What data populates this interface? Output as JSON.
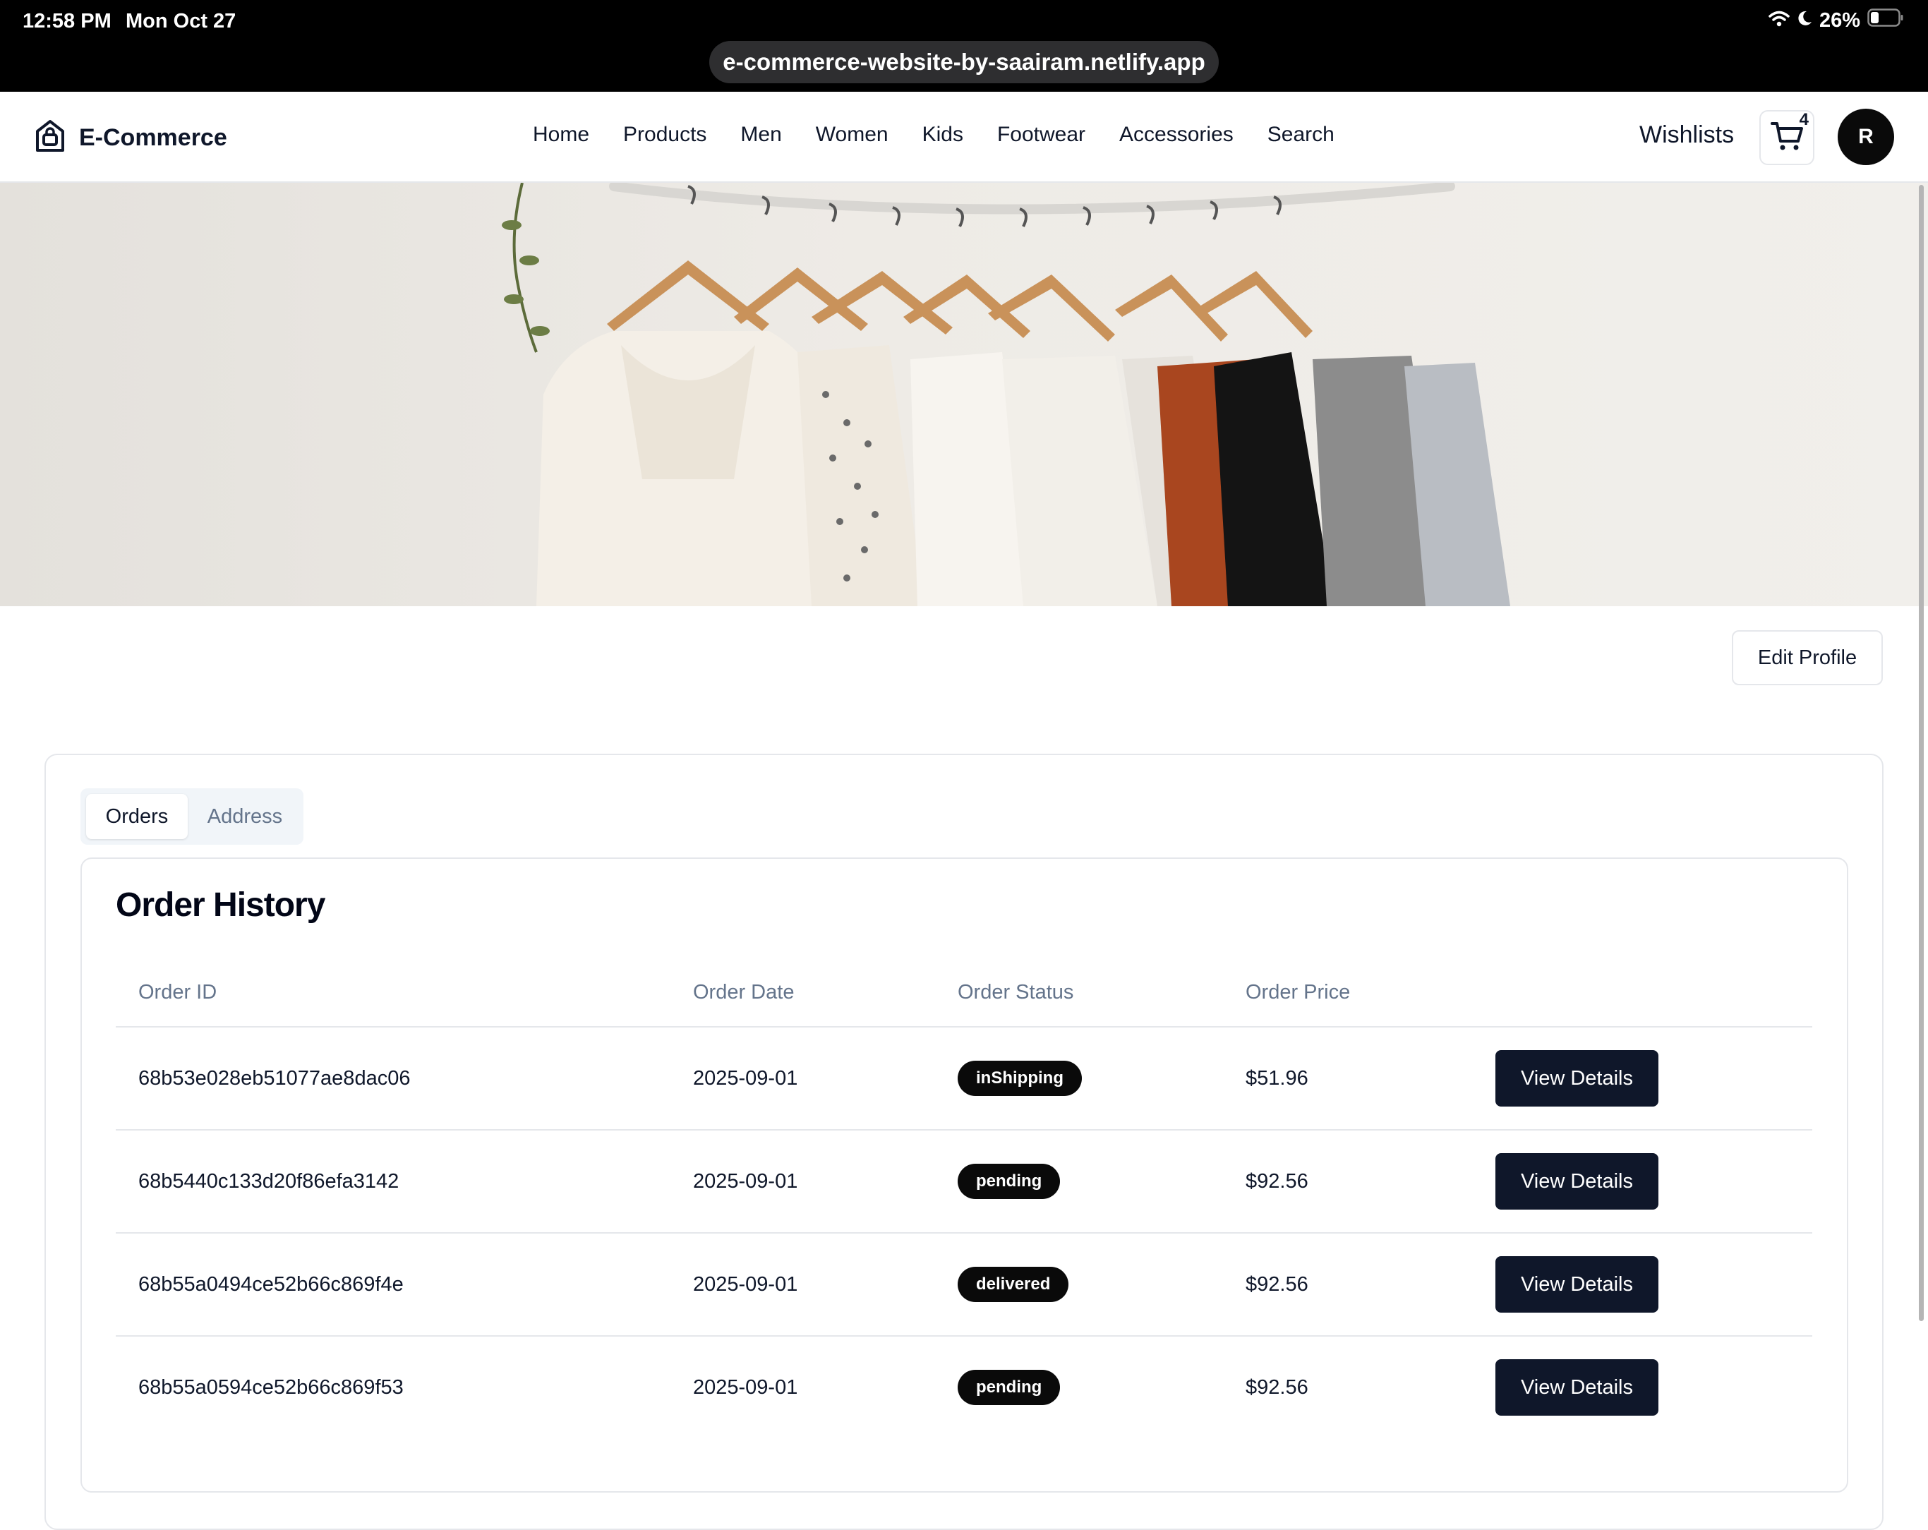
{
  "status_bar": {
    "time": "12:58 PM",
    "date": "Mon Oct 27",
    "battery": "26%",
    "url": "e-commerce-website-by-saairam.netlify.app"
  },
  "header": {
    "brand": "E-Commerce",
    "nav": [
      "Home",
      "Products",
      "Men",
      "Women",
      "Kids",
      "Footwear",
      "Accessories",
      "Search"
    ],
    "wishlists": "Wishlists",
    "cart_count": "4",
    "avatar_initial": "R"
  },
  "profile": {
    "edit_label": "Edit Profile",
    "tabs": [
      "Orders",
      "Address"
    ],
    "active_tab": "Orders"
  },
  "orders": {
    "title": "Order History",
    "columns": [
      "Order ID",
      "Order Date",
      "Order Status",
      "Order Price"
    ],
    "rows": [
      {
        "id": "68b53e028eb51077ae8dac06",
        "date": "2025-09-01",
        "status": "inShipping",
        "price": "$51.96",
        "action": "View Details"
      },
      {
        "id": "68b5440c133d20f86efa3142",
        "date": "2025-09-01",
        "status": "pending",
        "price": "$92.56",
        "action": "View Details"
      },
      {
        "id": "68b55a0494ce52b66c869f4e",
        "date": "2025-09-01",
        "status": "delivered",
        "price": "$92.56",
        "action": "View Details"
      },
      {
        "id": "68b55a0594ce52b66c869f53",
        "date": "2025-09-01",
        "status": "pending",
        "price": "$92.56",
        "action": "View Details"
      }
    ]
  },
  "colors": {
    "primary": "#0f172a",
    "muted": "#64748b",
    "border": "#e5e7eb",
    "badge": "#0a0a0a"
  }
}
